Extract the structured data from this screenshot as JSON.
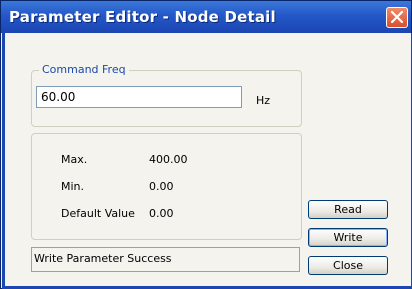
{
  "window": {
    "title": "Parameter Editor - Node Detail"
  },
  "command_group": {
    "legend": "Command Freq",
    "value": "60.00",
    "unit": "Hz"
  },
  "info": {
    "max_label": "Max.",
    "max_value": "400.00",
    "min_label": "Min.",
    "min_value": "0.00",
    "default_label": "Default Value",
    "default_value": "0.00"
  },
  "status": {
    "text": "Write Parameter Success"
  },
  "buttons": {
    "read": "Read",
    "write": "Write",
    "close": "Close"
  },
  "icons": {
    "close": "close-icon"
  },
  "colors": {
    "titlebar": "#2457c8",
    "close_button": "#d9502b",
    "legend_text": "#1a4aa8"
  }
}
